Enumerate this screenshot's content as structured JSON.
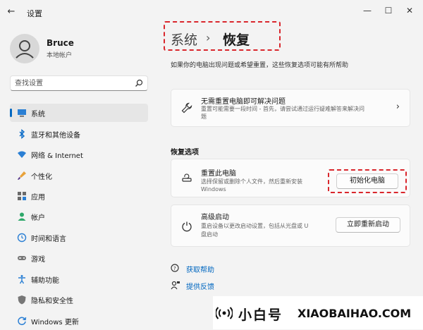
{
  "window": {
    "title": "设置",
    "controls": {
      "minimize": "—",
      "maximize": "☐",
      "close": "✕"
    }
  },
  "user": {
    "name": "Bruce",
    "account_type": "本地帐户"
  },
  "search": {
    "placeholder": "查找设置"
  },
  "sidebar": {
    "items": [
      {
        "label": "系统",
        "icon": "monitor-icon",
        "active": true
      },
      {
        "label": "蓝牙和其他设备",
        "icon": "bluetooth-icon"
      },
      {
        "label": "网络 & Internet",
        "icon": "wifi-icon"
      },
      {
        "label": "个性化",
        "icon": "brush-icon"
      },
      {
        "label": "应用",
        "icon": "apps-icon"
      },
      {
        "label": "帐户",
        "icon": "person-icon"
      },
      {
        "label": "时间和语言",
        "icon": "globe-clock-icon"
      },
      {
        "label": "游戏",
        "icon": "gamepad-icon"
      },
      {
        "label": "辅助功能",
        "icon": "accessibility-icon"
      },
      {
        "label": "隐私和安全性",
        "icon": "shield-icon"
      },
      {
        "label": "Windows 更新",
        "icon": "update-icon"
      }
    ]
  },
  "main": {
    "breadcrumb": {
      "root": "系统",
      "separator": "›",
      "current": "恢复"
    },
    "subtitle": "如果你的电脑出现问题或希望重置，这些恢复选项可能有所帮助",
    "troubleshoot_card": {
      "title": "无需重置电脑即可解决问题",
      "desc_line1": "重置可能需要一段时间 - 首先，请尝试通过运行疑难解答来解决问",
      "desc_line2": "题",
      "icon": "wrench-icon"
    },
    "section_title": "恢复选项",
    "reset_card": {
      "title": "重置此电脑",
      "desc_line1": "选择保留或删除个人文件，然后重新安装",
      "desc_line2": "Windows",
      "button": "初始化电脑",
      "icon": "reset-pc-icon"
    },
    "advanced_card": {
      "title": "高级启动",
      "desc_line1": "重启设备以更改启动设置，包括从光盘或 U",
      "desc_line2": "盘启动",
      "button": "立即重新启动",
      "icon": "advanced-startup-icon"
    },
    "links": [
      {
        "label": "获取帮助",
        "icon": "help-icon"
      },
      {
        "label": "提供反馈",
        "icon": "feedback-icon"
      }
    ]
  },
  "watermark": {
    "cn": "小白号",
    "en": "XIAOBAIHAO.COM"
  },
  "colors": {
    "accent": "#0067c0",
    "annotation": "#d9262c",
    "background": "#f3f3f3"
  }
}
